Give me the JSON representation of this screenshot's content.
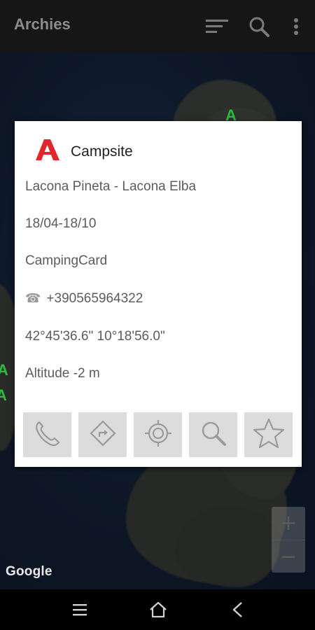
{
  "app": {
    "title": "Archies"
  },
  "toolbar": {
    "icons": [
      "sort-icon",
      "search-icon",
      "more-vert-icon"
    ]
  },
  "map": {
    "attribution": "Google",
    "zoom_in_label": "+",
    "zoom_out_label": "−"
  },
  "popup": {
    "category_icon": "campsite-logo-icon",
    "title": "Campsite",
    "name": "Lacona Pineta - Lacona Elba",
    "season": "18/04-18/10",
    "discount_card": "CampingCard",
    "phone_glyph": "☎",
    "phone": "+390565964322",
    "coordinates": "42°45'36.6\" 10°18'56.0\"",
    "altitude": "Altitude -2 m",
    "actions": [
      "call-icon",
      "directions-icon",
      "locate-icon",
      "zoom-search-icon",
      "favorite-star-icon"
    ]
  },
  "nav": {
    "icons": [
      "recent-apps-icon",
      "home-icon",
      "back-icon"
    ]
  },
  "colors": {
    "accent": "#e3262b",
    "marker_green": "#2bbd3d",
    "appbar": "#161616",
    "card": "#ffffff"
  }
}
